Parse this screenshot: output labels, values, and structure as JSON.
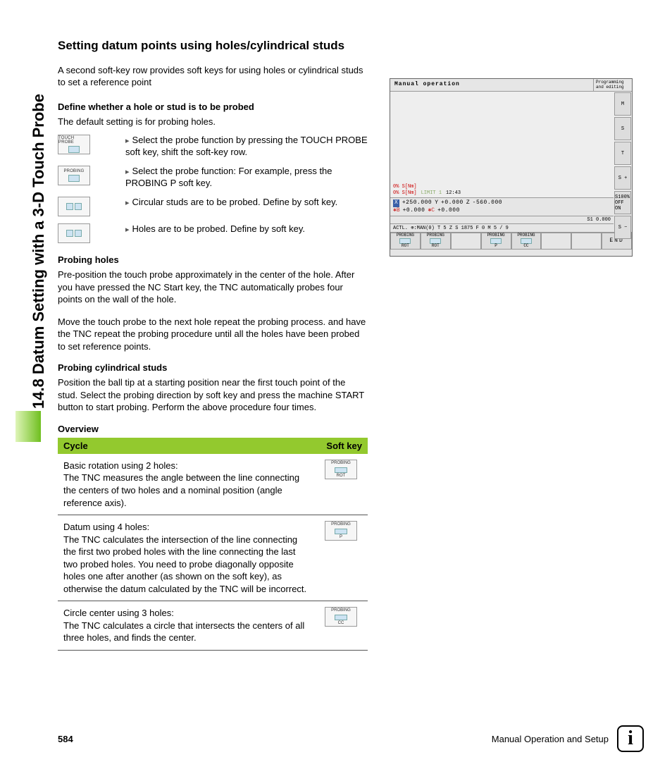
{
  "sidebar_label": "14.8 Datum Setting with a 3-D Touch Probe",
  "heading": "Setting datum points using holes/cylindrical studs",
  "intro": "A second soft-key row provides soft keys for using holes or cylindrical studs to set a reference point",
  "define_head": "Define whether a hole or stud is to be probed",
  "define_text": "The default setting is for probing holes.",
  "steps": [
    {
      "icon_label": "TOUCH PROBE",
      "text": "Select the probe function by pressing the TOUCH PROBE soft key, shift the soft-key row."
    },
    {
      "icon_label": "PROBING",
      "text": "Select the probe function: For example, press the PROBING P soft key."
    },
    {
      "icon_label": "",
      "text": "Circular studs are to be probed. Define by soft key."
    },
    {
      "icon_label": "",
      "text": "Holes are to be probed. Define by soft key."
    }
  ],
  "probing_holes_head": "Probing holes",
  "probing_holes_p1": "Pre-position the touch probe approximately in the center of the hole. After you have pressed the NC Start key, the TNC automatically probes four points on the wall of the hole.",
  "probing_holes_p2": "Move the touch probe to the next hole repeat the probing process. and have the TNC repeat the probing procedure until all the holes have been probed to set reference points.",
  "probing_studs_head": "Probing cylindrical studs",
  "probing_studs_p": "Position the ball tip at a starting position near the first touch point of the stud. Select the probing direction by soft key and press the machine START button to start probing. Perform the above procedure four times.",
  "overview_head": "Overview",
  "table": {
    "col1": "Cycle",
    "col2": "Soft key",
    "rows": [
      {
        "label": "PROBING",
        "sub": "ROT",
        "title": "Basic rotation using 2 holes:",
        "desc": "The TNC measures the angle between the line connecting the centers of two holes and a nominal position (angle reference axis)."
      },
      {
        "label": "PROBING",
        "sub": "P",
        "title": "Datum using 4 holes:",
        "desc": "The TNC calculates the intersection of the line connecting the first two probed holes with the line connecting the last two probed holes. You need to probe diagonally opposite holes one after another (as shown on the soft key), as otherwise the datum calculated by the TNC will be incorrect."
      },
      {
        "label": "PROBING",
        "sub": "CC",
        "title": "Circle center using 3 holes:",
        "desc": "The TNC calculates a circle that intersects the centers of all three holes, and finds the center."
      }
    ]
  },
  "tnc": {
    "title": "Manual operation",
    "submode": "Programming and editing",
    "status_l1": "0% S[Nm]",
    "status_l2a": "0% S[Nm]",
    "status_l2b": "LIMIT 1",
    "status_time": "12:43",
    "coords": {
      "X": "+250.000",
      "Y": "+0.000",
      "Z": "-560.000",
      "B": "+0.000",
      "C": "+0.000"
    },
    "info_s": "S1   0.000",
    "info_row": "ACTL.   ⊕:MAN(0)   T 5   Z S 1875   F 0   M 5 / 9",
    "right_buttons": [
      "M",
      "S",
      "T",
      "S +",
      "S100% OFF ON",
      "S −"
    ],
    "softkeys": [
      {
        "label": "PROBING",
        "sub": "ROT"
      },
      {
        "label": "PROBING",
        "sub": "ROT"
      },
      {
        "label": "",
        "sub": ""
      },
      {
        "label": "PROBING",
        "sub": "P"
      },
      {
        "label": "PROBING",
        "sub": "CC"
      },
      {
        "label": "",
        "sub": ""
      },
      {
        "label": "",
        "sub": ""
      },
      {
        "label": "END",
        "sub": ""
      }
    ]
  },
  "footer": {
    "page": "584",
    "section": "Manual Operation and Setup"
  }
}
